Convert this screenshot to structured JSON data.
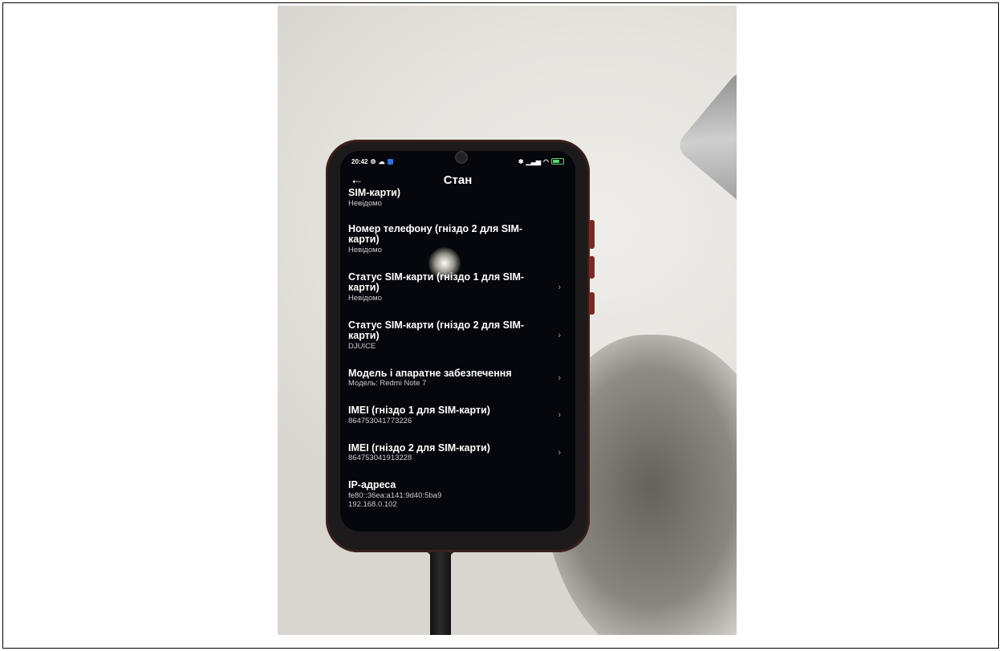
{
  "status_bar": {
    "time": "20:42",
    "left_icons": [
      "gear-icon",
      "cloud-icon",
      "app-badge-icon"
    ],
    "right_icons": [
      "bluetooth-icon",
      "signal-icon",
      "wifi-icon",
      "battery-icon"
    ]
  },
  "header": {
    "back_glyph": "←",
    "title": "Стан"
  },
  "items": [
    {
      "label": "SIM-карти)",
      "value": "Невідомо",
      "chevron": false
    },
    {
      "label": "Номер телефону (гніздо 2 для SIM-карти)",
      "value": "Невідомо",
      "chevron": false
    },
    {
      "label": "Статус SIM-карти (гніздо 1 для SIM-карти)",
      "value": "Невідомо",
      "chevron": true
    },
    {
      "label": "Статус SIM-карти (гніздо 2 для SIM-карти)",
      "value": "DJUICE",
      "chevron": true
    },
    {
      "label": "Модель і апаратне забезпечення",
      "value": "Модель: Redmi Note 7",
      "chevron": true
    },
    {
      "label": "IMEI (гніздо 1 для SIM-карти)",
      "value": "864753041773226",
      "chevron": true
    },
    {
      "label": "IMEI (гніздо 2 для SIM-карти)",
      "value": "864753041913228",
      "chevron": true
    },
    {
      "label": "IP-адреса",
      "value": "fe80::36ea:a141:9d40:5ba9\n192.168.0.102",
      "chevron": false
    }
  ],
  "chevron_glyph": "›"
}
